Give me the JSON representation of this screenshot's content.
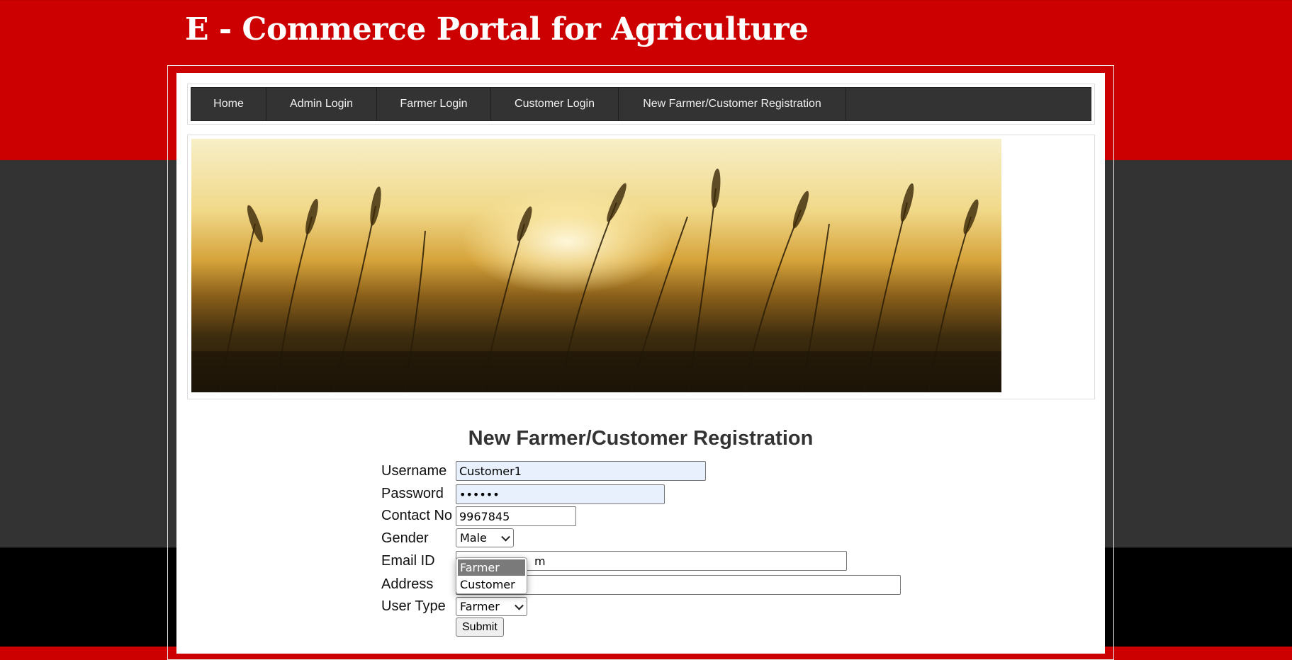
{
  "site_title": "E - Commerce Portal for Agriculture",
  "nav": {
    "items": [
      {
        "label": "Home",
        "name": "nav-home"
      },
      {
        "label": "Admin Login",
        "name": "nav-admin-login"
      },
      {
        "label": "Farmer Login",
        "name": "nav-farmer-login"
      },
      {
        "label": "Customer Login",
        "name": "nav-customer-login"
      },
      {
        "label": "New Farmer/Customer Registration",
        "name": "nav-registration"
      }
    ]
  },
  "banner": {
    "icon": "wheat-field-sunset-image"
  },
  "form": {
    "title": "New Farmer/Customer Registration",
    "labels": {
      "username": "Username",
      "password": "Password",
      "contact": "Contact No",
      "gender": "Gender",
      "email": "Email ID",
      "address": "Address",
      "user_type": "User Type"
    },
    "values": {
      "username": "Customer1",
      "password": "••••••",
      "contact": "9967845",
      "gender": "Male",
      "email_visible_tail": "m",
      "address": "",
      "user_type": "Farmer"
    },
    "user_type_options": [
      "Farmer",
      "Customer"
    ],
    "submit_label": "Submit"
  },
  "colors": {
    "header_red": "#cc0000",
    "nav_bg": "#333333",
    "band_dark": "#333333"
  }
}
